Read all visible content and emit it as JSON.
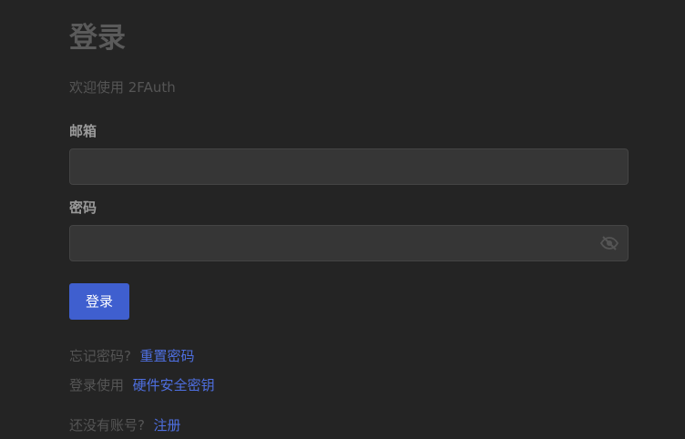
{
  "page": {
    "title": "登录",
    "subtitle": "欢迎使用 2FAuth"
  },
  "form": {
    "email_label": "邮箱",
    "email_value": "",
    "password_label": "密码",
    "password_value": "",
    "password_toggle_icon": "eye-slash-icon",
    "submit_label": "登录"
  },
  "links": {
    "forgot_text": "忘记密码?",
    "forgot_link": "重置密码",
    "webauthn_text": "登录使用",
    "webauthn_link": "硬件安全密钥",
    "register_text": "还没有账号?",
    "register_link": "注册"
  },
  "colors": {
    "background": "#242424",
    "accent": "#3f5fcf",
    "link": "#4e6fe0"
  }
}
